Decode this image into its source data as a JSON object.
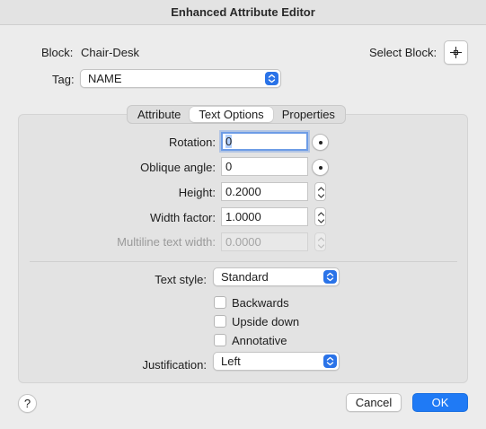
{
  "window": {
    "title": "Enhanced Attribute Editor"
  },
  "header": {
    "block_label": "Block:",
    "block_value": "Chair-Desk",
    "select_block_label": "Select Block:",
    "tag_label": "Tag:",
    "tag_value": "NAME"
  },
  "tabs": [
    {
      "label": "Attribute",
      "active": false
    },
    {
      "label": "Text Options",
      "active": true
    },
    {
      "label": "Properties",
      "active": false
    }
  ],
  "text_options": {
    "rotation": {
      "label": "Rotation:",
      "value": "0"
    },
    "oblique": {
      "label": "Oblique angle:",
      "value": "0"
    },
    "height": {
      "label": "Height:",
      "value": "0.2000"
    },
    "width_factor": {
      "label": "Width factor:",
      "value": "1.0000"
    },
    "multiline_width": {
      "label": "Multiline text width:",
      "value": "0.0000",
      "disabled": true
    },
    "text_style": {
      "label": "Text style:",
      "value": "Standard"
    },
    "backwards": {
      "label": "Backwards",
      "checked": false
    },
    "upside_down": {
      "label": "Upside down",
      "checked": false
    },
    "annotative": {
      "label": "Annotative",
      "checked": false
    },
    "justification": {
      "label": "Justification:",
      "value": "Left"
    }
  },
  "footer": {
    "help_label": "?",
    "cancel_label": "Cancel",
    "ok_label": "OK"
  },
  "colors": {
    "accent": "#1f7af5",
    "focus_ring": "#6d9ce6"
  },
  "icons": [
    "pick-point-icon",
    "chevron-updown-icon",
    "angle-dial-icon",
    "stepper-arrows-icon"
  ]
}
